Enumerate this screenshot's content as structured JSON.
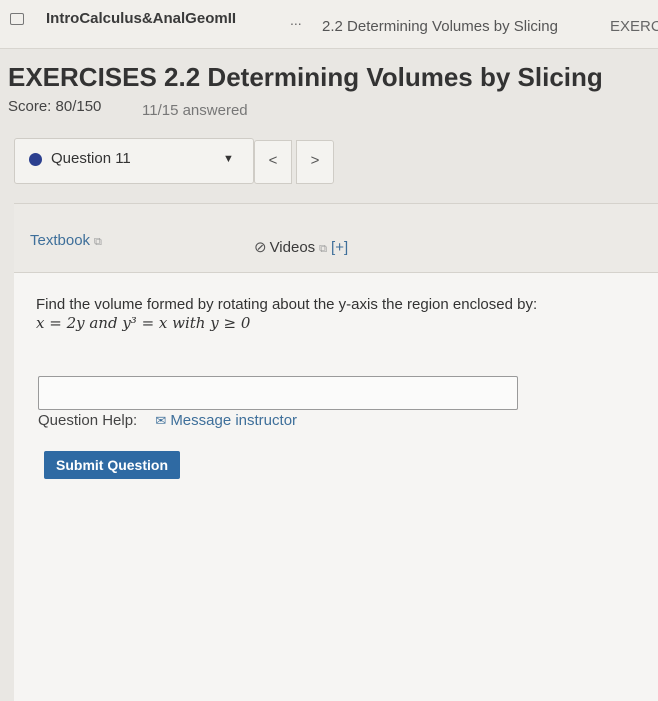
{
  "breadcrumb": {
    "course": "IntroCalculus&AnalGeomII",
    "ellipsis": "...",
    "current": "2.2 Determining Volumes by Slicing",
    "next": "EXERC"
  },
  "header": {
    "title": "EXERCISES 2.2 Determining Volumes by Slicing",
    "score": "Score: 80/150",
    "answered": "11/15 answered"
  },
  "question_nav": {
    "selected": "Question 11",
    "prev_label": "<",
    "next_label": ">"
  },
  "toolbar": {
    "textbook_label": "Textbook",
    "videos_label": "Videos",
    "expand_label": "[+]"
  },
  "question": {
    "text": "Find the volume formed by rotating about the y-axis the region enclosed by:",
    "math": "x = 2y and y³ = x with y ≥ 0"
  },
  "answer": {
    "value": ""
  },
  "help": {
    "label": "Question Help:",
    "message_label": "Message instructor"
  },
  "submit_label": "Submit Question",
  "colors": {
    "accent": "#2f6aa3",
    "link": "#3e6f9a",
    "status_dot": "#2b3f8f"
  }
}
